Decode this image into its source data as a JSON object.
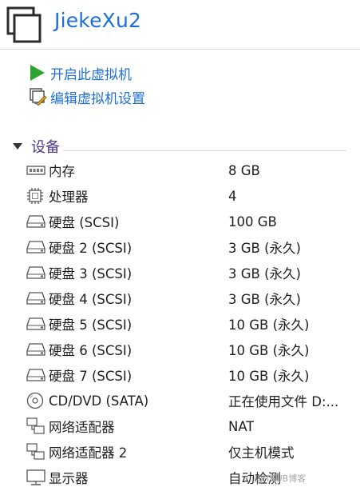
{
  "vm": {
    "title": "JiekeXu2"
  },
  "actions": [
    {
      "label": "开启此虚拟机",
      "icon": "play-icon"
    },
    {
      "label": "编辑虚拟机设置",
      "icon": "edit-settings-icon"
    }
  ],
  "devices_section": {
    "label": "设备"
  },
  "devices": [
    {
      "name": "内存",
      "value": "8 GB",
      "icon": "memory-icon"
    },
    {
      "name": "处理器",
      "value": "4",
      "icon": "processor-icon"
    },
    {
      "name": "硬盘 (SCSI)",
      "value": "100 GB",
      "icon": "hard-disk-icon"
    },
    {
      "name": "硬盘 2 (SCSI)",
      "value": "3 GB (永久)",
      "icon": "hard-disk-icon"
    },
    {
      "name": "硬盘 3 (SCSI)",
      "value": "3 GB (永久)",
      "icon": "hard-disk-icon"
    },
    {
      "name": "硬盘 4 (SCSI)",
      "value": "3 GB (永久)",
      "icon": "hard-disk-icon"
    },
    {
      "name": "硬盘 5 (SCSI)",
      "value": "10 GB (永久)",
      "icon": "hard-disk-icon"
    },
    {
      "name": "硬盘 6 (SCSI)",
      "value": "10 GB (永久)",
      "icon": "hard-disk-icon"
    },
    {
      "name": "硬盘 7 (SCSI)",
      "value": "10 GB (永久)",
      "icon": "hard-disk-icon"
    },
    {
      "name": "CD/DVD (SATA)",
      "value": "正在使用文件 D:...",
      "icon": "cd-dvd-icon"
    },
    {
      "name": "网络适配器",
      "value": "NAT",
      "icon": "network-adapter-icon"
    },
    {
      "name": "网络适配器 2",
      "value": "仅主机模式",
      "icon": "network-adapter-icon"
    },
    {
      "name": "显示器",
      "value": "自动检测",
      "icon": "monitor-icon"
    }
  ],
  "watermark": {
    "text": "@ITPUB博客"
  },
  "colors": {
    "title_blue": "#1e6fd8",
    "section_purple": "#4a3a8a",
    "play_green": "#2fa32f"
  }
}
